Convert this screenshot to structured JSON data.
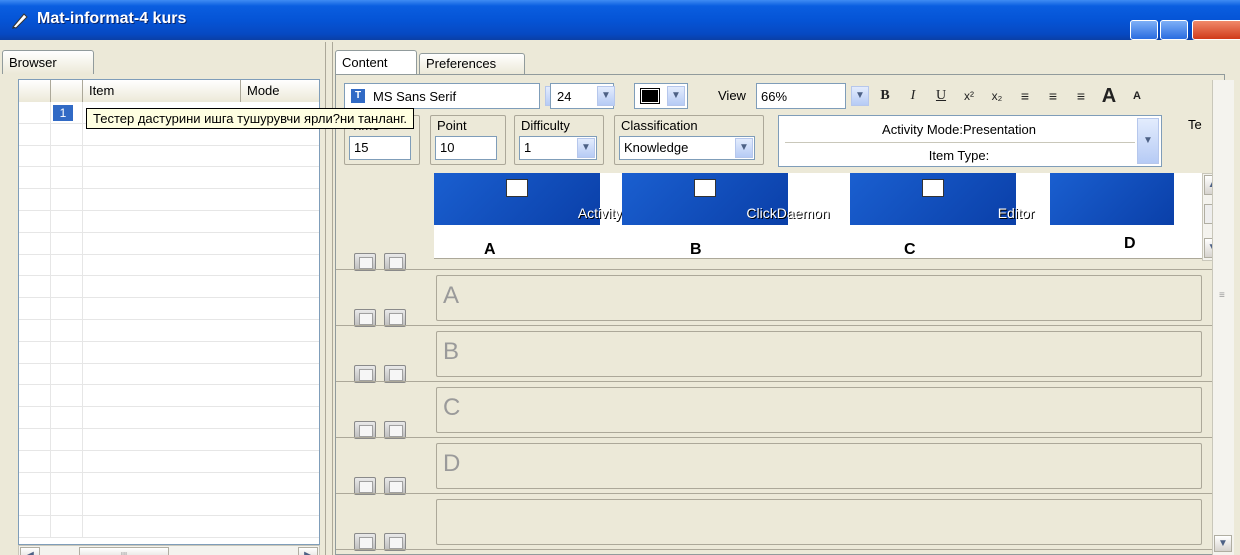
{
  "window": {
    "title": "Mat-informat-4 kurs"
  },
  "left": {
    "tab": "Browser",
    "columns": [
      "",
      "",
      "Item",
      "Mode"
    ],
    "rows": [
      {
        "number": "1"
      }
    ]
  },
  "tooltip": {
    "text": "Тестер дастурини ишга тушурувчи ярли?ни танланг."
  },
  "right": {
    "tabs": [
      "Content",
      "Preferences"
    ],
    "toolbar": {
      "font": "MS Sans Serif",
      "size": "24",
      "view_label": "View",
      "view_value": "66%",
      "bold": "B",
      "italic": "I",
      "underline": "U",
      "superscript": "x²",
      "subscript": "x₂",
      "grow": "A",
      "shrink": "A"
    },
    "fields": {
      "time": {
        "label": "Time",
        "value": "15"
      },
      "point": {
        "label": "Point",
        "value": "10"
      },
      "difficulty": {
        "label": "Difficulty",
        "value": "1"
      },
      "classification": {
        "label": "Classification",
        "value": "Knowledge"
      }
    },
    "activity": {
      "mode": "Activity Mode:Presentation",
      "type": "Item Type:"
    },
    "te_label": "Te",
    "images": [
      {
        "caption": "Activity",
        "letter": "A"
      },
      {
        "caption": "ClickDaemon",
        "letter": "B"
      },
      {
        "caption": "Editor",
        "letter": "C"
      },
      {
        "caption": "",
        "letter": "D"
      }
    ],
    "options": [
      "A",
      "B",
      "C",
      "D",
      ""
    ]
  },
  "colors": {
    "titlebar": "#0554d6",
    "selection": "#316ac5",
    "tooltip_bg": "#ffffe1",
    "face": "#ece9d8"
  }
}
